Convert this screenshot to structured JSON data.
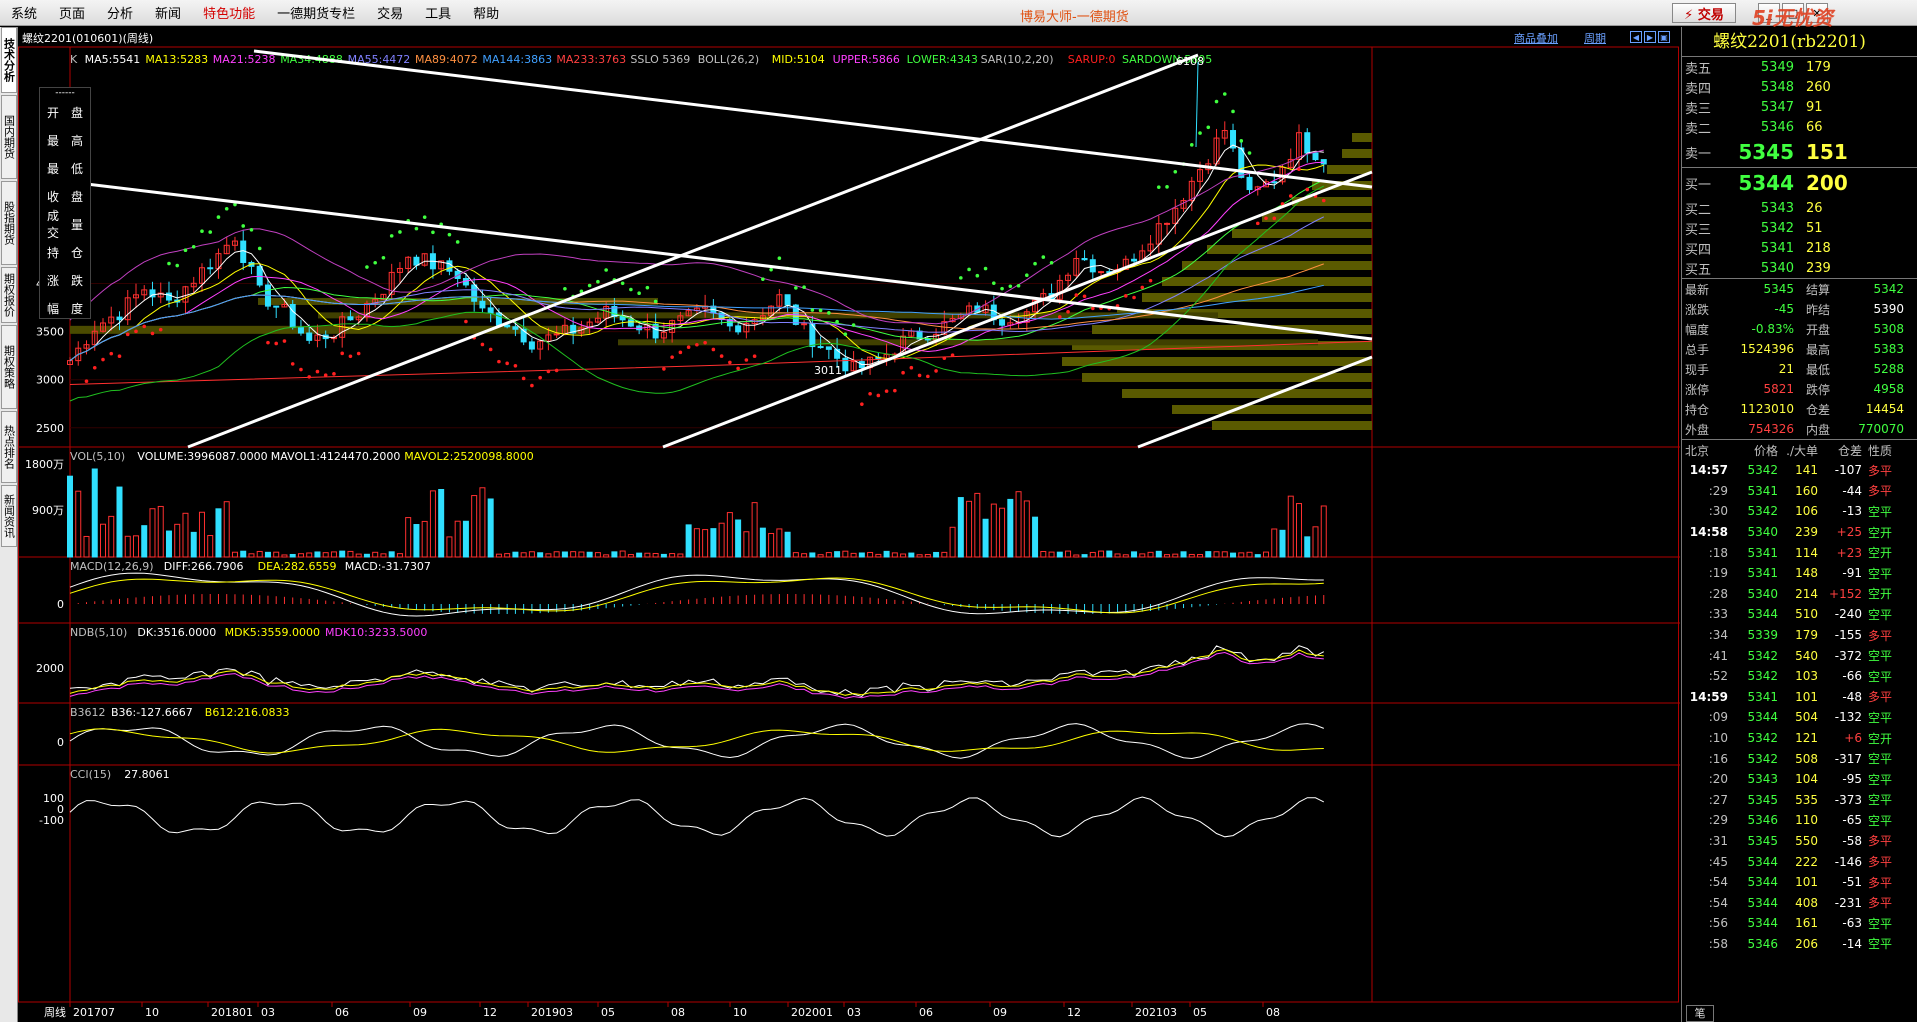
{
  "menu": {
    "items": [
      "系统",
      "页面",
      "分析",
      "新闻",
      "特色功能",
      "一德期货专栏",
      "交易",
      "工具",
      "帮助"
    ],
    "special_index": 4,
    "app_title": "博易大师-一德期货",
    "trade_button": "⚡ 交易",
    "watermark": "5i无忧资5etz.com"
  },
  "left_tabs": [
    "技术分析",
    "国内期货",
    "股指期货",
    "期权报价",
    "期权策略",
    "热点排名",
    "新闻资讯"
  ],
  "side_panel": {
    "dash": "------",
    "rows": [
      [
        "开",
        "盘"
      ],
      [
        "最",
        "高"
      ],
      [
        "最",
        "低"
      ],
      [
        "收",
        "盘"
      ],
      [
        "成交",
        "量"
      ],
      [
        "持",
        "仓"
      ],
      [
        "涨",
        "跌"
      ],
      [
        "幅",
        "度"
      ]
    ]
  },
  "chart_header": {
    "symbol": "螺纹2201(010601)(周线)",
    "overlay_label": "商品叠加",
    "period_label": "周期"
  },
  "indicators": {
    "main": [
      {
        "text": "K",
        "color": "#c0c0c0"
      },
      {
        "text": "MA5:5541",
        "color": "#ffffff"
      },
      {
        "text": "MA13:5283",
        "color": "#ffff00"
      },
      {
        "text": "MA21:5238",
        "color": "#ff40ff"
      },
      {
        "text": "MA34:4888",
        "color": "#40ff40"
      },
      {
        "text": "MA55:4472",
        "color": "#8080ff"
      },
      {
        "text": "MA89:4072",
        "color": "#ff9040"
      },
      {
        "text": "MA144:3863",
        "color": "#40a0ff"
      },
      {
        "text": "MA233:3763",
        "color": "#ff4040"
      },
      {
        "text": "SSLO 5369",
        "color": "#c0c0c0"
      },
      {
        "text": "BOLL(26,2)",
        "color": "#c0c0c0"
      },
      {
        "text": "MID:5104",
        "color": "#ffff00"
      },
      {
        "text": "UPPER:5866",
        "color": "#ff40ff"
      },
      {
        "text": "LOWER:4343",
        "color": "#40ff40"
      },
      {
        "text": "SAR(10,2,20)",
        "color": "#c0c0c0"
      },
      {
        "text": "SARUP:0",
        "color": "#ff2020"
      },
      {
        "text": "SARDOWN:5805",
        "color": "#40ff40"
      }
    ],
    "vol": [
      {
        "text": "VOL(5,10)",
        "color": "#c0c0c0"
      },
      {
        "text": "VOLUME:3996087.0000",
        "color": "#ffffff"
      },
      {
        "text": "MAVOL1:4124470.2000",
        "color": "#ffffff"
      },
      {
        "text": "MAVOL2:2520098.8000",
        "color": "#ffff00"
      }
    ],
    "macd": [
      {
        "text": "MACD(12,26,9)",
        "color": "#c0c0c0"
      },
      {
        "text": "DIFF:266.7906",
        "color": "#ffffff"
      },
      {
        "text": "DEA:282.6559",
        "color": "#ffff00"
      },
      {
        "text": "MACD:-31.7307",
        "color": "#ffffff"
      }
    ],
    "ndb": [
      {
        "text": "NDB(5,10)",
        "color": "#c0c0c0"
      },
      {
        "text": "DK:3516.0000",
        "color": "#ffffff"
      },
      {
        "text": "MDK5:3559.0000",
        "color": "#ffff00"
      },
      {
        "text": "MDK10:3233.5000",
        "color": "#ff40ff"
      }
    ],
    "b3612": [
      {
        "text": "B3612",
        "color": "#c0c0c0"
      },
      {
        "text": "B36:-127.6667",
        "color": "#ffffff"
      },
      {
        "text": "B612:216.0833",
        "color": "#ffff00"
      }
    ],
    "cci": [
      {
        "text": "CCI(15)",
        "color": "#c0c0c0"
      },
      {
        "text": "27.8061",
        "color": "#ffffff"
      }
    ]
  },
  "axis": {
    "main_ticks": [
      [
        "4000",
        4000
      ],
      [
        "3500",
        3500
      ],
      [
        "3000",
        3000
      ],
      [
        "2500",
        2500
      ]
    ],
    "vol_ticks": [
      [
        "1800万",
        1800
      ],
      [
        "900万",
        900
      ]
    ],
    "macd_tick": "0",
    "ndb_tick": "2000",
    "b3612_tick": "0",
    "cci_ticks": [
      "100",
      "0",
      "-100"
    ],
    "x_label_first": "周线",
    "x_ticks": [
      "201707",
      "10",
      "201801",
      "03",
      "06",
      "09",
      "12",
      "201903",
      "05",
      "08",
      "10",
      "202001",
      "03",
      "06",
      "09",
      "12",
      "202103",
      "05",
      "08"
    ],
    "high_label": "6108",
    "low_label": "3011"
  },
  "chart_data": {
    "type": "candlestick",
    "x_label": "周线",
    "price_range": [
      2300,
      6200
    ],
    "main_high": 6108,
    "main_low": 3011,
    "close_path": [
      [
        0,
        3200
      ],
      [
        3,
        3550
      ],
      [
        6,
        3700
      ],
      [
        9,
        3950
      ],
      [
        12,
        3800
      ],
      [
        15,
        4050
      ],
      [
        18,
        4300
      ],
      [
        20,
        4500
      ],
      [
        23,
        3900
      ],
      [
        26,
        3700
      ],
      [
        29,
        3400
      ],
      [
        32,
        3500
      ],
      [
        35,
        3700
      ],
      [
        38,
        3950
      ],
      [
        41,
        4300
      ],
      [
        44,
        4200
      ],
      [
        47,
        4100
      ],
      [
        50,
        3700
      ],
      [
        53,
        3600
      ],
      [
        56,
        3400
      ],
      [
        59,
        3450
      ],
      [
        62,
        3550
      ],
      [
        65,
        3700
      ],
      [
        68,
        3600
      ],
      [
        71,
        3500
      ],
      [
        74,
        3600
      ],
      [
        77,
        3700
      ],
      [
        80,
        3550
      ],
      [
        83,
        3650
      ],
      [
        86,
        3850
      ],
      [
        89,
        3500
      ],
      [
        92,
        3300
      ],
      [
        95,
        3100
      ],
      [
        98,
        3200
      ],
      [
        101,
        3400
      ],
      [
        104,
        3500
      ],
      [
        107,
        3600
      ],
      [
        110,
        3750
      ],
      [
        113,
        3650
      ],
      [
        116,
        3700
      ],
      [
        119,
        3900
      ],
      [
        122,
        4300
      ],
      [
        125,
        4150
      ],
      [
        128,
        4200
      ],
      [
        131,
        4500
      ],
      [
        134,
        4800
      ],
      [
        137,
        5200
      ],
      [
        140,
        5600
      ],
      [
        143,
        4900
      ],
      [
        146,
        5100
      ],
      [
        149,
        5500
      ],
      [
        152,
        5300
      ]
    ],
    "right_bars": [
      [
        1,
        20,
        3
      ],
      [
        2,
        30,
        2
      ],
      [
        3,
        45,
        1
      ],
      [
        4,
        60,
        2
      ],
      [
        5,
        80,
        4
      ],
      [
        6,
        110,
        3
      ],
      [
        7,
        140,
        1
      ],
      [
        8,
        165,
        2
      ],
      [
        9,
        190,
        3
      ],
      [
        10,
        210,
        4
      ],
      [
        11,
        230,
        2
      ],
      [
        12,
        255,
        1
      ],
      [
        13,
        280,
        3
      ],
      [
        14,
        300,
        2
      ],
      [
        15,
        310,
        2
      ],
      [
        16,
        290,
        1
      ],
      [
        17,
        250,
        3
      ],
      [
        18,
        200,
        4
      ],
      [
        19,
        160,
        2
      ]
    ],
    "volume_profile": [
      [
        1,
        18
      ],
      [
        2,
        30
      ],
      [
        3,
        50
      ],
      [
        4,
        80
      ],
      [
        5,
        120
      ],
      [
        6,
        160
      ],
      [
        7,
        200
      ],
      [
        8,
        240
      ],
      [
        9,
        260
      ],
      [
        10,
        240
      ],
      [
        11,
        200
      ],
      [
        12,
        160
      ],
      [
        13,
        120
      ],
      [
        14,
        80
      ],
      [
        15,
        40
      ]
    ]
  },
  "quote": {
    "title": "螺纹2201(rb2201)",
    "asks": [
      [
        "卖五",
        "5349",
        "179"
      ],
      [
        "卖四",
        "5348",
        "260"
      ],
      [
        "卖三",
        "5347",
        "91"
      ],
      [
        "卖二",
        "5346",
        "66"
      ]
    ],
    "ask1": [
      "卖一",
      "5345",
      "151"
    ],
    "bid1": [
      "买一",
      "5344",
      "200"
    ],
    "bids": [
      [
        "买二",
        "5343",
        "26"
      ],
      [
        "买三",
        "5342",
        "51"
      ],
      [
        "买四",
        "5341",
        "218"
      ],
      [
        "买五",
        "5340",
        "239"
      ]
    ],
    "stats": [
      [
        "最新",
        "5345",
        "dn",
        "结算",
        "5342",
        "dn"
      ],
      [
        "涨跌",
        "-45",
        "dn",
        "昨结",
        "5390",
        "wh"
      ],
      [
        "幅度",
        "-0.83%",
        "dn",
        "开盘",
        "5308",
        "dn"
      ],
      [
        "总手",
        "1524396",
        "yl",
        "最高",
        "5383",
        "dn"
      ],
      [
        "现手",
        "21",
        "yl",
        "最低",
        "5288",
        "dn"
      ],
      [
        "涨停",
        "5821",
        "up",
        "跌停",
        "4958",
        "dn"
      ],
      [
        "持仓",
        "1123010",
        "yl",
        "仓差",
        "14454",
        "yl"
      ],
      [
        "外盘",
        "754326",
        "up",
        "内盘",
        "770070",
        "dn"
      ]
    ],
    "ticks_header": [
      "北京",
      "价格",
      "./大单",
      "仓差",
      "性质"
    ],
    "ticks": [
      [
        "14:57",
        "5342",
        "141",
        "-107",
        "多平",
        true
      ],
      [
        ":29",
        "5341",
        "160",
        "-44",
        "多平",
        false
      ],
      [
        ":30",
        "5342",
        "106",
        "-13",
        "空平",
        false
      ],
      [
        "14:58",
        "5340",
        "239",
        "+25",
        "空开",
        true
      ],
      [
        ":18",
        "5341",
        "114",
        "+23",
        "空开",
        false
      ],
      [
        ":19",
        "5341",
        "148",
        "-91",
        "空平",
        false
      ],
      [
        ":28",
        "5340",
        "214",
        "+152",
        "空开",
        false
      ],
      [
        ":33",
        "5344",
        "510",
        "-240",
        "空平",
        false
      ],
      [
        ":34",
        "5339",
        "179",
        "-155",
        "多平",
        false
      ],
      [
        ":41",
        "5342",
        "540",
        "-372",
        "空平",
        false
      ],
      [
        ":52",
        "5342",
        "103",
        "-66",
        "空平",
        false
      ],
      [
        "14:59",
        "5341",
        "101",
        "-48",
        "多平",
        true
      ],
      [
        ":09",
        "5344",
        "504",
        "-132",
        "空平",
        false
      ],
      [
        ":10",
        "5342",
        "121",
        "+6",
        "空开",
        false
      ],
      [
        ":16",
        "5342",
        "508",
        "-317",
        "空平",
        false
      ],
      [
        ":20",
        "5343",
        "104",
        "-95",
        "空平",
        false
      ],
      [
        ":27",
        "5345",
        "535",
        "-373",
        "空平",
        false
      ],
      [
        ":29",
        "5346",
        "110",
        "-65",
        "空平",
        false
      ],
      [
        ":31",
        "5345",
        "550",
        "-58",
        "多平",
        false
      ],
      [
        ":45",
        "5344",
        "222",
        "-146",
        "多平",
        false
      ],
      [
        ":54",
        "5344",
        "101",
        "-51",
        "多平",
        false
      ],
      [
        ":54",
        "5344",
        "408",
        "-231",
        "多平",
        false
      ],
      [
        ":56",
        "5344",
        "161",
        "-63",
        "空平",
        false
      ],
      [
        ":58",
        "5346",
        "206",
        "-14",
        "空平",
        false
      ]
    ]
  },
  "bottom_tab": "笔"
}
